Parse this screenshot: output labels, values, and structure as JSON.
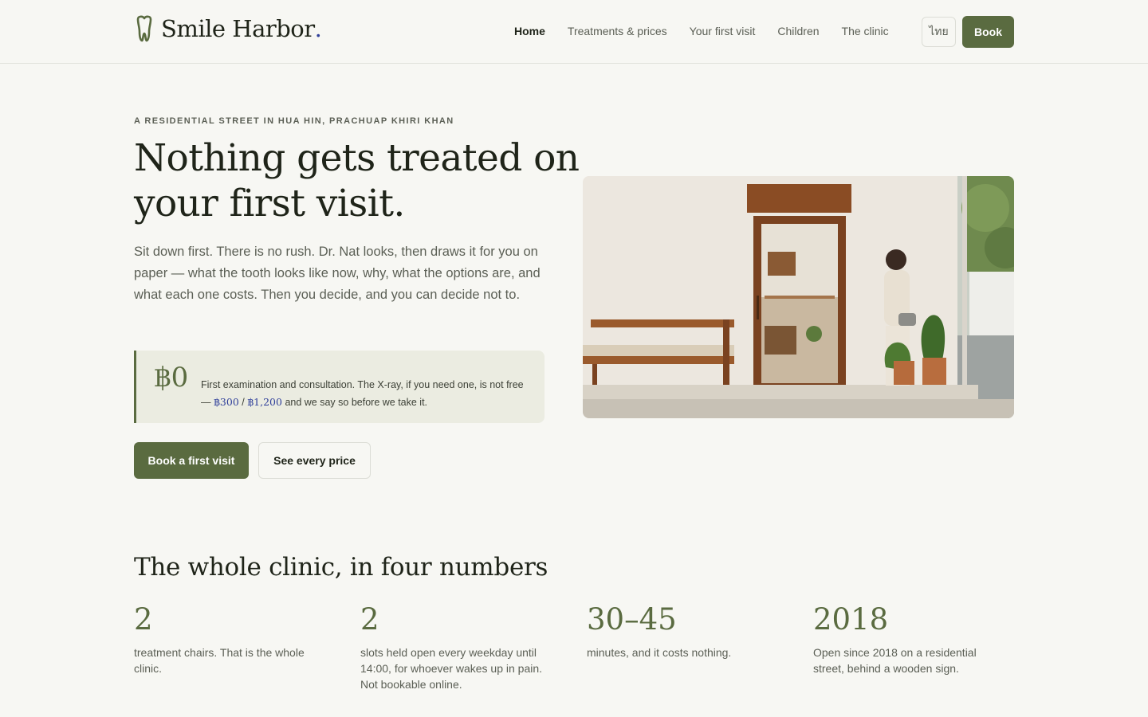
{
  "brand": {
    "name": "Smile Harbor",
    "dot": ".",
    "accent": "#2f3f9a",
    "primary": "#5a6b40"
  },
  "nav": {
    "items": [
      {
        "label": "Home",
        "active": true
      },
      {
        "label": "Treatments & prices",
        "active": false
      },
      {
        "label": "Your first visit",
        "active": false
      },
      {
        "label": "Children",
        "active": false
      },
      {
        "label": "The clinic",
        "active": false
      }
    ],
    "lang_label": "ไทย",
    "book_label": "Book"
  },
  "hero": {
    "eyebrow": "A RESIDENTIAL STREET IN HUA HIN, PRACHUAP KHIRI KHAN",
    "headline": "Nothing gets treated on your first visit.",
    "lede": "Sit down first. There is no rush. Dr. Nat looks, then draws it for you on paper — what the tooth looks like now, why, what the options are, and what each one costs. Then you decide, and you can decide not to.",
    "price": {
      "amount": "฿0",
      "text_before": "First examination and consultation. The X-ray, if you need one, is not free — ",
      "price_a": "฿300",
      "separator": " / ",
      "price_b": "฿1,200",
      "text_after": " and we say so before we take it."
    },
    "cta_primary": "Book a first visit",
    "cta_secondary": "See every price"
  },
  "numbers": {
    "title": "The whole clinic, in four numbers",
    "items": [
      {
        "value": "2",
        "desc": "treatment chairs. That is the whole clinic."
      },
      {
        "value": "2",
        "desc": "slots held open every weekday until 14:00, for whoever wakes up in pain. Not bookable online."
      },
      {
        "value": "30–45",
        "desc": "minutes, and it costs nothing."
      },
      {
        "value": "2018",
        "desc": "Open since 2018 on a residential street, behind a wooden sign."
      }
    ]
  }
}
